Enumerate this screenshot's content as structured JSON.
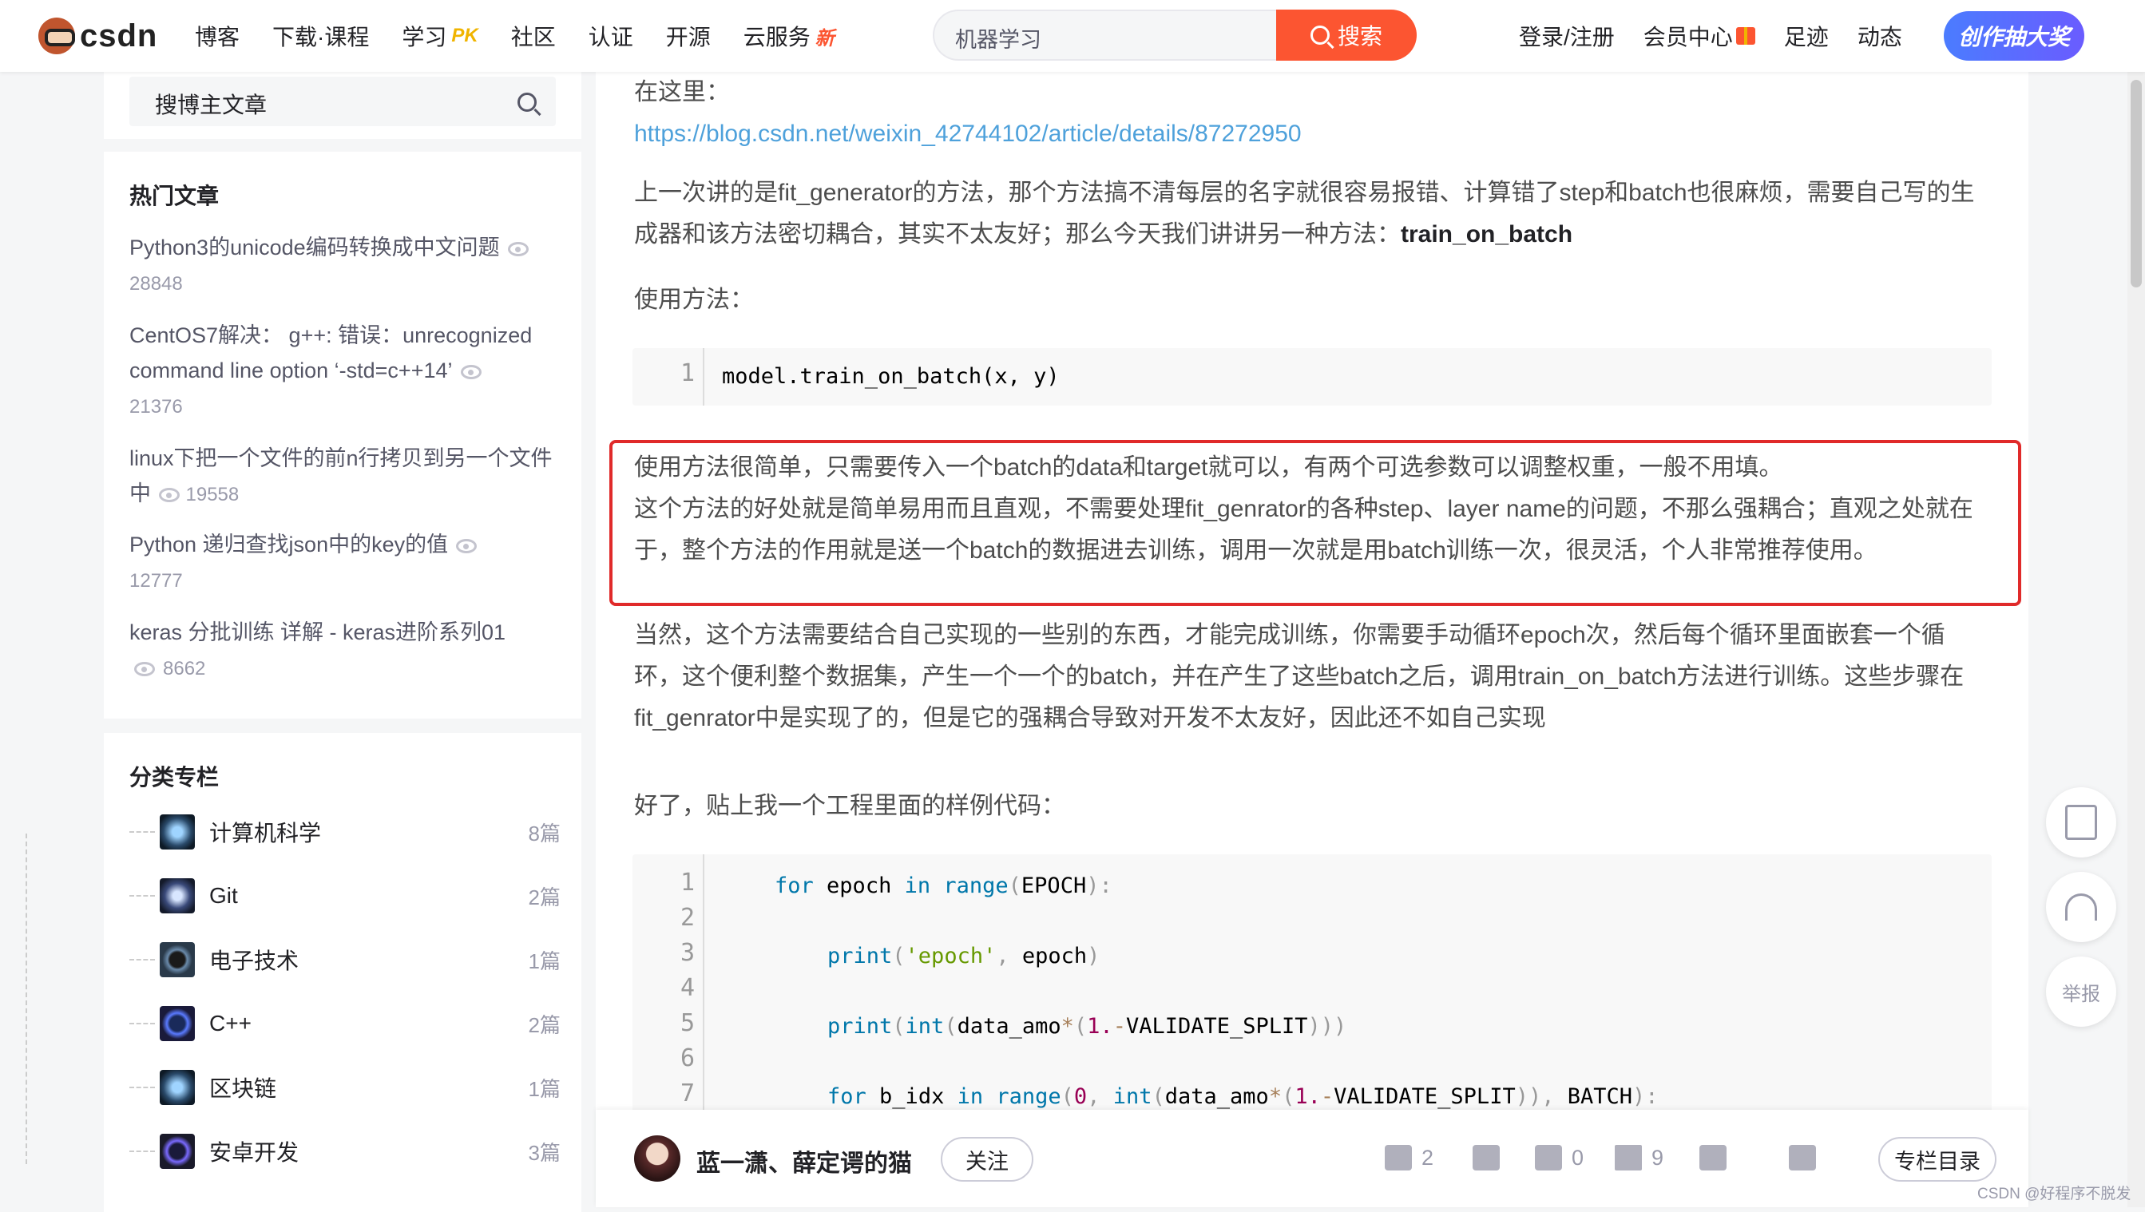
{
  "topbar": {
    "logo_text": "csdn",
    "nav": [
      {
        "label": "博客",
        "badge": ""
      },
      {
        "label": "下载·课程",
        "badge": ""
      },
      {
        "label": "学习",
        "badge": "PK"
      },
      {
        "label": "社区",
        "badge": ""
      },
      {
        "label": "认证",
        "badge": ""
      },
      {
        "label": "开源",
        "badge": ""
      },
      {
        "label": "云服务",
        "badge": "新"
      }
    ],
    "search_value": "机器学习",
    "search_button": "搜索",
    "right": {
      "login": "登录/注册",
      "vip": "会员中心",
      "footprint": "足迹",
      "dynamic": "动态",
      "create": "创作抽大奖"
    }
  },
  "sidebar": {
    "search_placeholder": "搜博主文章",
    "hot_title": "热门文章",
    "hot_articles": [
      {
        "title": "Python3的unicode编码转换成中文问题",
        "views": "28848"
      },
      {
        "title": "CentOS7解决： g++: 错误：unrecognized command line option ‘-std=c++14’",
        "views": "21376"
      },
      {
        "title": "linux下把一个文件的前n行拷贝到另一个文件中",
        "views": "19558"
      },
      {
        "title": "Python 递归查找json中的key的值",
        "views": "12777"
      },
      {
        "title": "keras 分批训练 详解 - keras进阶系列01",
        "views": "8662"
      }
    ],
    "category_title": "分类专栏",
    "categories": [
      {
        "name": "计算机科学",
        "count": "8篇"
      },
      {
        "name": "Git",
        "count": "2篇"
      },
      {
        "name": "电子技术",
        "count": "1篇"
      },
      {
        "name": "C++",
        "count": "2篇"
      },
      {
        "name": "区块链",
        "count": "1篇"
      },
      {
        "name": "安卓开发",
        "count": "3篇"
      }
    ]
  },
  "article": {
    "p_here": "在这里：",
    "link": "https://blog.csdn.net/weixin_42744102/article/details/87272950",
    "p_intro": "上一次讲的是fit_generator的方法，那个方法搞不清每层的名字就很容易报错、计算错了step和batch也很麻烦，需要自己写的生成器和该方法密切耦合，其实不太友好；那么今天我们讲讲另一种方法：",
    "p_intro_bold": "train_on_batch",
    "p_usage": "使用方法：",
    "code1": "model.train_on_batch(x, y)",
    "p_box1": "使用方法很简单，只需要传入一个batch的data和target就可以，有两个可选参数可以调整权重，一般不用填。",
    "p_box2": "这个方法的好处就是简单易用而且直观，不需要处理fit_genrator的各种step、layer name的问题，不那么强耦合；直观之处就在于，整个方法的作用就是送一个batch的数据进去训练，调用一次就是用batch训练一次，很灵活，个人非常推荐使用。",
    "p_loop": "当然，这个方法需要结合自己实现的一些别的东西，才能完成训练，你需要手动循环epoch次，然后每个循环里面嵌套一个循环，这个便利整个数据集，产生一个一个的batch，并在产生了这些batch之后，调用train_on_batch方法进行训练。这些步骤在fit_genrator中是实现了的，但是它的强耦合导致对开发不太友好，因此还不如自己实现",
    "p_sample": "好了，贴上我一个工程里面的样例代码：",
    "line_numbers": [
      "1",
      "2",
      "3",
      "4",
      "5",
      "6",
      "7"
    ]
  },
  "bottom": {
    "author": "蓝一潇、薛定谔的猫",
    "follow": "关注",
    "likes": "2",
    "comments": "0",
    "favorites": "9",
    "column_btn": "专栏目录"
  },
  "floating": {
    "report": "举报"
  },
  "watermark": "CSDN @好程序不脱发",
  "colors": {
    "accent": "#fc5531",
    "link": "#4ea1db",
    "highlight": "#e02a2a"
  }
}
